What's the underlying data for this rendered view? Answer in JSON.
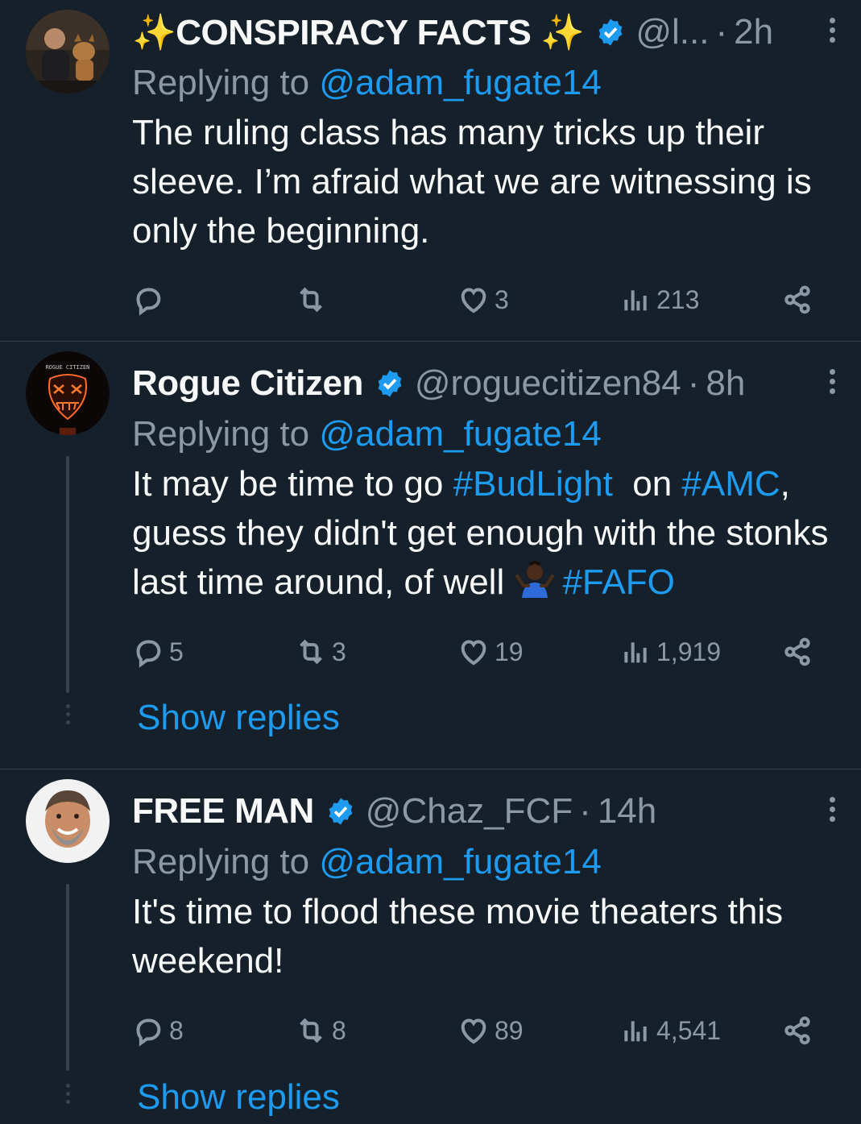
{
  "tweets": [
    {
      "name": "✨CONSPIRACY FACTS ✨",
      "handle": "@l...",
      "time": "2h",
      "replying_prefix": "Replying to ",
      "replying_to": "@adam_fugate14",
      "text": "The ruling class has many tricks up their sleeve. I’m afraid what we are witnessing is only the beginning.",
      "replies": "",
      "retweets": "",
      "likes": "3",
      "views": "213"
    },
    {
      "name": "Rogue Citizen",
      "handle": "@roguecitizen84",
      "time": "8h",
      "replying_prefix": "Replying to ",
      "replying_to": "@adam_fugate14",
      "text_parts": {
        "p1": "It may be time to go ",
        "h1": "#BudLight",
        "p2": "  on ",
        "h2": "#AMC",
        "p3": ", guess they didn't get enough with the stonks last time around, of well ",
        "h3": "#FAFO"
      },
      "replies": "5",
      "retweets": "3",
      "likes": "19",
      "views": "1,919",
      "show_replies": "Show replies",
      "avatar_text": "ROGUE CITIZEN"
    },
    {
      "name": "FREE MAN",
      "handle": "@Chaz_FCF",
      "time": "14h",
      "replying_prefix": "Replying to ",
      "replying_to": "@adam_fugate14",
      "text": "It's time to flood these movie theaters this weekend!",
      "replies": "8",
      "retweets": "8",
      "likes": "89",
      "views": "4,541",
      "show_replies": "Show replies"
    }
  ],
  "colors": {
    "background": "#15202b",
    "accent": "#1d9bf0",
    "muted": "#8b98a5",
    "divider": "#38444d"
  },
  "icons": [
    "reply-icon",
    "retweet-icon",
    "like-icon",
    "views-icon",
    "share-icon",
    "verified-badge-icon",
    "more-options-icon"
  ]
}
